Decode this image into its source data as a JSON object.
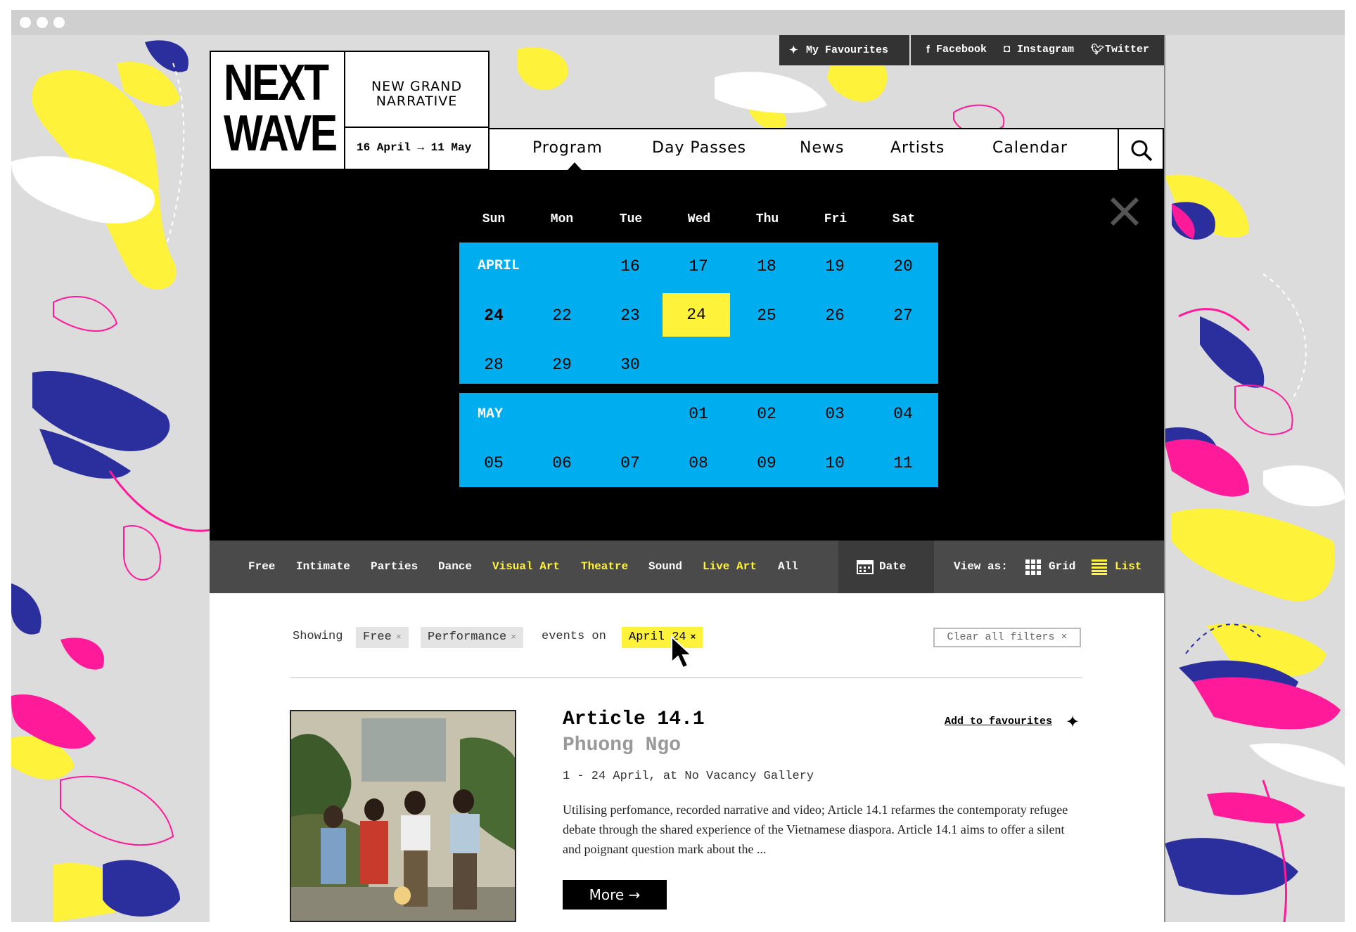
{
  "topbar": {
    "favourites": "My Favourites",
    "facebook": "Facebook",
    "instagram": "Instagram",
    "twitter": "Twitter"
  },
  "logo": {
    "line1": "NEXT",
    "line2": "WAVE"
  },
  "tagline": {
    "line1": "NEW GRAND",
    "line2": "NARRATIVE"
  },
  "festival_dates": "16 April → 11 May",
  "nav": {
    "items": [
      "Program",
      "Day Passes",
      "News",
      "Artists",
      "Calendar"
    ],
    "active": "Program"
  },
  "calendar": {
    "weekdays": [
      "Sun",
      "Mon",
      "Tue",
      "Wed",
      "Thu",
      "Fri",
      "Sat"
    ],
    "april": {
      "label": "APRIL",
      "row1": [
        "16",
        "17",
        "18",
        "19",
        "20"
      ],
      "row2": [
        "24",
        "22",
        "23",
        "24",
        "25",
        "26",
        "27"
      ],
      "row3": [
        "28",
        "29",
        "30"
      ]
    },
    "may": {
      "label": "MAY",
      "row1": [
        "01",
        "02",
        "03",
        "04"
      ],
      "row2": [
        "05",
        "06",
        "07",
        "08",
        "09",
        "10",
        "11"
      ]
    },
    "selected_day": "24"
  },
  "filters": {
    "items": [
      "Free",
      "Intimate",
      "Parties",
      "Dance",
      "Visual Art",
      "Theatre",
      "Sound",
      "Live Art",
      "All"
    ],
    "active": [
      "Visual Art",
      "Theatre",
      "Live Art"
    ]
  },
  "date_button": "Date",
  "view_as": {
    "label": "View as:",
    "grid": "Grid",
    "list": "List",
    "active": "List"
  },
  "showing": {
    "prefix": "Showing",
    "chip1": "Free",
    "chip2": "Performance",
    "middle": "events on",
    "date_chip": "April 24",
    "remove": "×"
  },
  "clear_filters": "Clear all filters ×",
  "event": {
    "title": "Article 14.1",
    "artist": "Phuong Ngo",
    "when_where": "1 - 24 April, at No Vacancy Gallery",
    "description": "Utilising perfomance, recorded narrative and video; Article 14.1 refarmes the contemporaty refugee debate through the shared experience of the Vietnamese diaspora. Article 14.1 aims to offer a silent and poignant question mark about the ...",
    "add_favourites": "Add to favourites",
    "more": "More →"
  },
  "colors": {
    "accent_yellow": "#fff23a",
    "calendar_blue": "#00aeef",
    "magenta": "#ff1a99",
    "navy": "#2b2f9e",
    "bar_dark": "#4a4a4a"
  }
}
